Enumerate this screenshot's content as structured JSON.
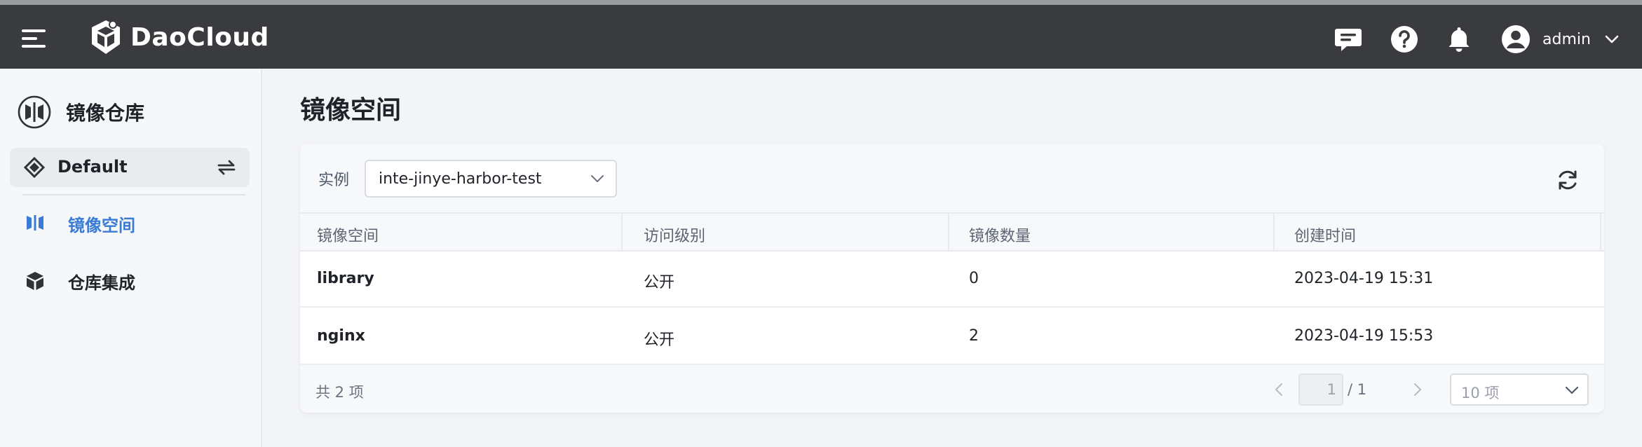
{
  "topbar": {
    "brand": "DaoCloud",
    "user_name": "admin",
    "icons": [
      "menu-icon",
      "message-icon",
      "help-icon",
      "bell-icon",
      "user-avatar-icon",
      "chevron-down-icon"
    ]
  },
  "sidebar": {
    "module_title": "镜像仓库",
    "workspace": "Default",
    "items": [
      {
        "label": "镜像空间",
        "active": true,
        "icon": "registry-space-icon"
      },
      {
        "label": "仓库集成",
        "active": false,
        "icon": "package-icon"
      }
    ]
  },
  "main": {
    "title": "镜像空间",
    "filter": {
      "label": "实例",
      "value": "inte-jinye-harbor-test"
    },
    "table": {
      "columns": [
        "镜像空间",
        "访问级别",
        "镜像数量",
        "创建时间"
      ],
      "rows": [
        {
          "name": "library",
          "access": "公开",
          "count": "0",
          "created": "2023-04-19 15:31"
        },
        {
          "name": "nginx",
          "access": "公开",
          "count": "2",
          "created": "2023-04-19 15:53"
        }
      ]
    },
    "pagination": {
      "total": "共 2 项",
      "page": "1",
      "page_total": "/ 1",
      "page_size": "10 项"
    }
  },
  "colors": {
    "topbar": "#3a3b3f",
    "accent": "#3a7bd5",
    "sidebar_bg": "#f6f7f9"
  }
}
